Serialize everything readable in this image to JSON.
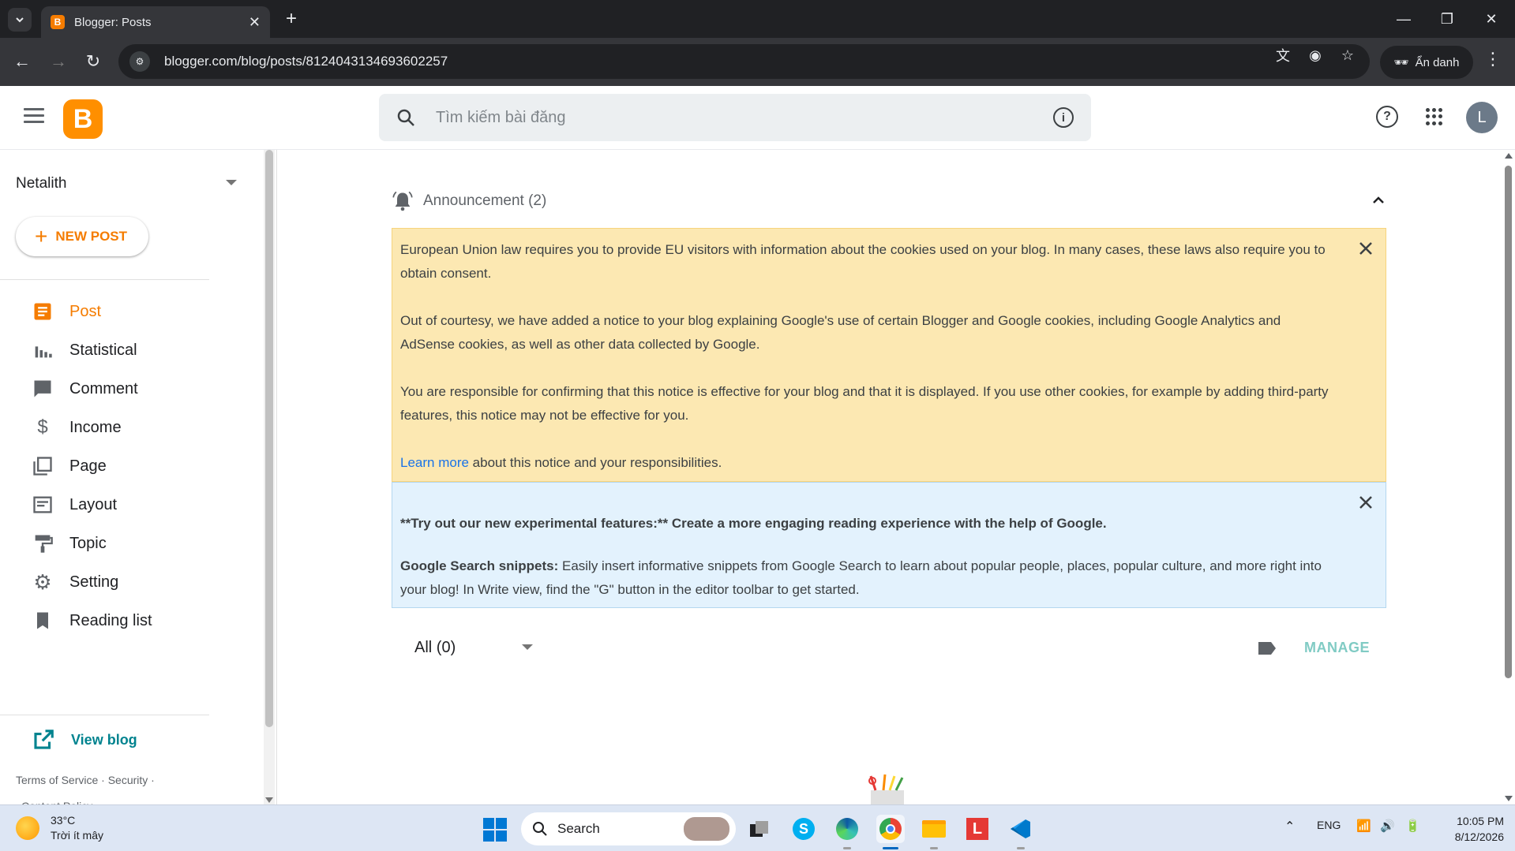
{
  "browser": {
    "tab_title": "Blogger: Posts",
    "url": "blogger.com/blog/posts/8124043134693602257",
    "profile_label": "Ẩn danh"
  },
  "header": {
    "search_placeholder": "Tìm kiếm bài đăng",
    "avatar_letter": "L",
    "logo_letter": "B"
  },
  "sidebar": {
    "blog_name": "Netalith",
    "new_post_label": "NEW POST",
    "items": [
      {
        "label": "Post",
        "icon": "posts-icon",
        "active": true
      },
      {
        "label": "Statistical",
        "icon": "stats-icon",
        "active": false
      },
      {
        "label": "Comment",
        "icon": "comment-icon",
        "active": false
      },
      {
        "label": "Income",
        "icon": "dollar-icon",
        "active": false
      },
      {
        "label": "Page",
        "icon": "pages-icon",
        "active": false
      },
      {
        "label": "Layout",
        "icon": "layout-icon",
        "active": false
      },
      {
        "label": "Topic",
        "icon": "paint-roller-icon",
        "active": false
      },
      {
        "label": "Setting",
        "icon": "gear-icon",
        "active": false
      },
      {
        "label": "Reading list",
        "icon": "bookmark-icon",
        "active": false
      }
    ],
    "view_blog_label": "View blog",
    "footer": {
      "terms": "Terms of Service",
      "security": "Security",
      "content_policy": "Content Policy"
    }
  },
  "main": {
    "announcement_title": "Announcement (2)",
    "notice_yellow": {
      "p1": "European Union law requires you to provide EU visitors with information about the cookies used on your blog. In many cases, these laws also require you to obtain consent.",
      "p2": "Out of courtesy, we have added a notice to your blog explaining Google's use of certain Blogger and Google cookies, including Google Analytics and AdSense cookies, as well as other data collected by Google.",
      "p3": "You are responsible for confirming that this notice is effective for your blog and that it is displayed. If you use other cookies, for example by adding third-party features, this notice may not be effective for you.",
      "learn_more": "Learn more",
      "p4_rest": " about this notice and your responsibilities."
    },
    "notice_blue": {
      "headline": "**Try out our new experimental features:** Create a more engaging reading experience with the help of Google.",
      "snippet_label": "Google Search snippets:",
      "snippet_text": " Easily insert informative snippets from Google Search to learn about popular people, places, popular culture, and more right into your blog! In Write view, find the \"G\" button in the editor toolbar to get started."
    },
    "filter_label": "All (0)",
    "manage_label": "MANAGE"
  },
  "taskbar": {
    "temperature": "33°C",
    "weather_desc": "Trời ít mây",
    "search_label": "Search",
    "language": "ENG",
    "time": "10:05 PM",
    "date": "8/12/2026"
  },
  "colors": {
    "blogger_orange": "#f57c00",
    "notice_yellow": "#fce8b2",
    "notice_blue": "#e3f2fd",
    "teal": "#00838f"
  }
}
